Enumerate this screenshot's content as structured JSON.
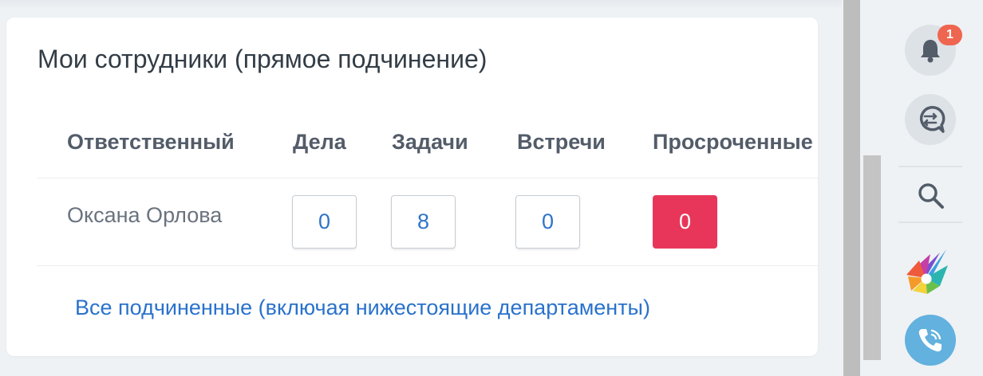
{
  "widget": {
    "title": "Мои сотрудники (прямое подчинение)",
    "columns": [
      "Ответственный",
      "Дела",
      "Задачи",
      "Встречи",
      "Просроченные"
    ],
    "rows": [
      {
        "name": "Оксана Орлова",
        "deals": "0",
        "tasks": "8",
        "meetings": "0",
        "overdue": "0"
      }
    ],
    "all_link": "Все подчиненные (включая нижестоящие департаменты)"
  },
  "sidebar": {
    "notifications_badge": "1",
    "icons": [
      "bell-icon",
      "chat-icon",
      "search-icon",
      "logo-icon",
      "phone-icon"
    ]
  },
  "colors": {
    "overdue": "#e8365a",
    "link": "#2a72cc",
    "badge": "#ef6650",
    "phone": "#62b1de"
  }
}
